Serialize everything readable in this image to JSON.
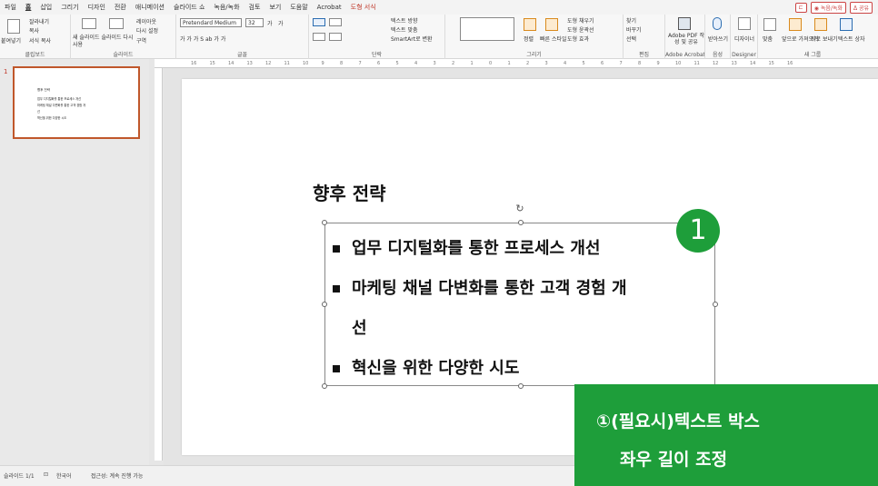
{
  "tabs": [
    "파일",
    "홈",
    "삽입",
    "그리기",
    "디자인",
    "전환",
    "애니메이션",
    "슬라이드 쇼",
    "녹음/녹화",
    "검토",
    "보기",
    "도움말",
    "Acrobat",
    "도형 서식"
  ],
  "active_tab": "홈",
  "top_right": {
    "comment": "⊏",
    "record": "◉ 녹음/녹화",
    "share": "ᐃ 공유"
  },
  "ribbon": {
    "clipboard": {
      "label": "클립보드",
      "paste": "붙여넣기",
      "cut": "잘라내기",
      "copy": "복사",
      "format_painter": "서식 복사"
    },
    "slides": {
      "label": "슬라이드",
      "new_slide": "새 슬라이드",
      "reuse": "슬라이드 다시 사용",
      "layout": "레이아웃",
      "reset": "다시 설정",
      "section": "구역"
    },
    "font": {
      "label": "글꼴",
      "font_name": "Pretendard Medium",
      "font_size": "32",
      "grow": "가",
      "shrink": "가",
      "row2": "가  가  가  S  ab  가  가"
    },
    "paragraph": {
      "label": "단락",
      "direction": "텍스트 방향",
      "align": "텍스트 맞춤",
      "smartart": "SmartArt로 변환"
    },
    "drawing": {
      "label": "그리기",
      "arrange": "정렬",
      "quick_styles": "빠른 스타일",
      "fill": "도형 채우기",
      "outline": "도형 윤곽선",
      "effects": "도형 효과"
    },
    "editing": {
      "label": "편집",
      "find": "찾기",
      "replace": "바꾸기",
      "select": "선택"
    },
    "acrobat": {
      "label": "Adobe Acrobat",
      "btn": "Adobe PDF 작성 및 공유"
    },
    "voice": {
      "label": "음성",
      "btn": "받아쓰기"
    },
    "designer": {
      "label": "Designer",
      "btn": "디자이너"
    },
    "new_group": {
      "label": "새 그룹",
      "b1": "맞춤",
      "b2": "앞으로 가져오기",
      "b3": "뒤로 보내기",
      "b4": "텍스트 상자"
    }
  },
  "ruler_numbers": [
    "16",
    "15",
    "14",
    "13",
    "12",
    "11",
    "10",
    "9",
    "8",
    "7",
    "6",
    "5",
    "4",
    "3",
    "2",
    "1",
    "0",
    "1",
    "2",
    "3",
    "4",
    "5",
    "6",
    "7",
    "8",
    "9",
    "10",
    "11",
    "12",
    "13",
    "14",
    "15",
    "16"
  ],
  "slide_panel": {
    "number": "1"
  },
  "slide": {
    "title": "향후 전략",
    "bullets": [
      "업무 디지털화를 통한 프로세스 개선",
      "마케팅 채널 다변화를 통한 고객 경험 개",
      "선",
      "혁신을 위한 다양한 시도"
    ]
  },
  "marker": "1",
  "callout": {
    "line1": "①(필요시)텍스트 박스",
    "line2": "좌우 길이 조정"
  },
  "status": {
    "slide": "슬라이드 1/1",
    "lang": "한국어",
    "access": "접근성: 계속 진행 가능"
  },
  "colors": {
    "accent_green": "#1e9e3a",
    "selection": "#c0572b"
  }
}
